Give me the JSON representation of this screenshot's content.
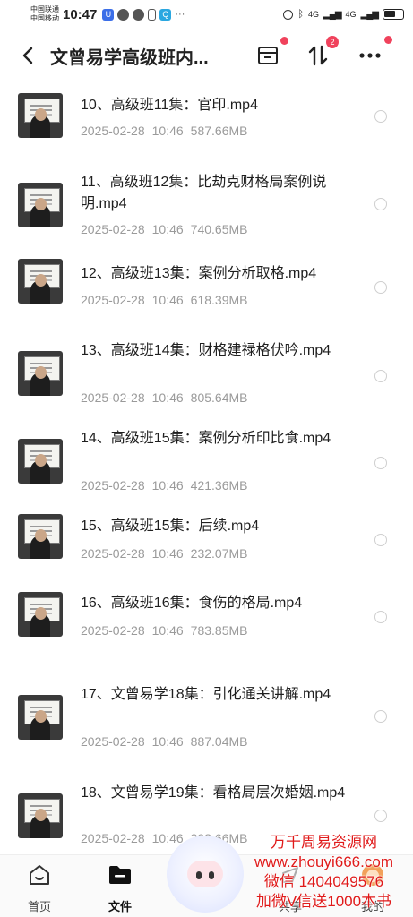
{
  "status_bar": {
    "carrier_1": "中国联通",
    "carrier_2": "中国移动",
    "time": "10:47",
    "network_1": "4G",
    "network_2": "4G"
  },
  "header": {
    "title": "文曾易学高级班内...",
    "back_icon": "chevron-left-icon",
    "sort_badge": "2"
  },
  "files": [
    {
      "name": "10、高级班11集：官印.mp4",
      "date": "2025-02-28",
      "time": "10:46",
      "size": "587.66MB"
    },
    {
      "name": "11、高级班12集：比劫克财格局案例说明.mp4",
      "date": "2025-02-28",
      "time": "10:46",
      "size": "740.65MB"
    },
    {
      "name": "12、高级班13集：案例分析取格.mp4",
      "date": "2025-02-28",
      "time": "10:46",
      "size": "618.39MB"
    },
    {
      "name": "13、高级班14集：财格建禄格伏吟.mp4",
      "date": "2025-02-28",
      "time": "10:46",
      "size": "805.64MB"
    },
    {
      "name": "14、高级班15集：案例分析印比食.mp4",
      "date": "2025-02-28",
      "time": "10:46",
      "size": "421.36MB"
    },
    {
      "name": "15、高级班15集：后续.mp4",
      "date": "2025-02-28",
      "time": "10:46",
      "size": "232.07MB"
    },
    {
      "name": "16、高级班16集：食伤的格局.mp4",
      "date": "2025-02-28",
      "time": "10:46",
      "size": "783.85MB"
    },
    {
      "name": "17、文曾易学18集：引化通关讲解.mp4",
      "date": "2025-02-28",
      "time": "10:46",
      "size": "887.04MB"
    },
    {
      "name": "18、文曾易学19集：看格局层次婚姻.mp4",
      "date": "2025-02-28",
      "time": "10:46",
      "size": "393.66MB"
    }
  ],
  "bottom_nav": {
    "home": "首页",
    "files": "文件",
    "share": "共享",
    "mine": "我的"
  },
  "watermark": {
    "line1": "万千周易资源网",
    "line2": "www.zhouyi666.com",
    "line3": "微信 1404049576",
    "line4": "加微V信送1000本书"
  },
  "colors": {
    "accent_red": "#f0425c",
    "watermark_red": "#e01a1a",
    "meta_gray": "#9a9a9a"
  }
}
